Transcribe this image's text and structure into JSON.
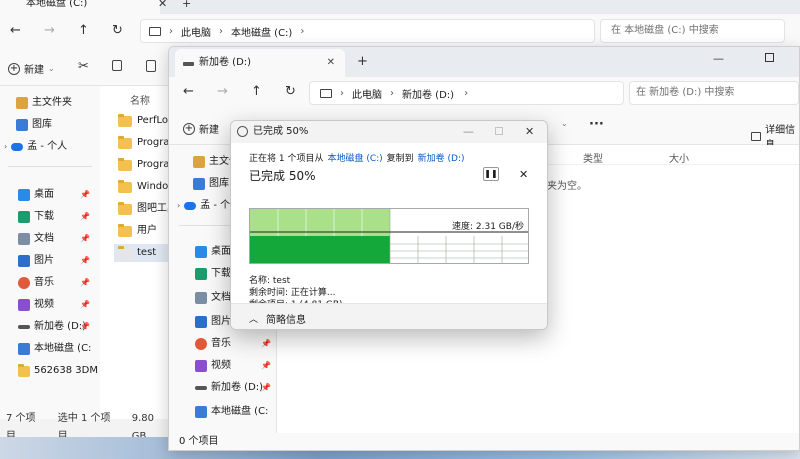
{
  "back_window": {
    "tab_title": "本地磁盘 (C:)",
    "breadcrumb": [
      "此电脑",
      "本地磁盘 (C:)"
    ],
    "search_placeholder": "在 本地磁盘 (C:) 中搜索",
    "new_label": "新建",
    "column_name": "名称",
    "nav": [
      {
        "label": "主文件夹",
        "icon": "home-icon"
      },
      {
        "label": "图库",
        "icon": "gallery-icon"
      },
      {
        "label": "孟 - 个人",
        "icon": "cloud-icon"
      },
      {
        "label": "桌面",
        "icon": "desktop-icon"
      },
      {
        "label": "下载",
        "icon": "download-icon"
      },
      {
        "label": "文档",
        "icon": "document-icon"
      },
      {
        "label": "图片",
        "icon": "pictures-icon"
      },
      {
        "label": "音乐",
        "icon": "music-icon"
      },
      {
        "label": "视频",
        "icon": "video-icon"
      },
      {
        "label": "新加卷 (D:)",
        "icon": "drive-icon"
      },
      {
        "label": "本地磁盘 (C:",
        "icon": "drive-icon"
      },
      {
        "label": "562638 3DM",
        "icon": "folder-icon"
      }
    ],
    "files": [
      "PerfLog",
      "Progran",
      "Progran",
      "Window",
      "图吧工具",
      "用户",
      "test"
    ],
    "status": {
      "count": "7 个项目",
      "selected": "选中 1 个项目",
      "size": "9.80 GB"
    }
  },
  "front_window": {
    "tab_title": "新加卷 (D:)",
    "breadcrumb": [
      "此电脑",
      "新加卷 (D:)"
    ],
    "search_placeholder": "在 新加卷 (D:) 中搜索",
    "new_label": "新建",
    "details_label": "详细信息",
    "columns": [
      "类型",
      "大小"
    ],
    "empty_text": "夹为空。",
    "nav": [
      {
        "label": "主文件",
        "icon": "home-icon"
      },
      {
        "label": "图库",
        "icon": "gallery-icon"
      },
      {
        "label": "孟 - 个",
        "icon": "cloud-icon"
      },
      {
        "label": "桌面",
        "icon": "desktop-icon"
      },
      {
        "label": "下载",
        "icon": "download-icon"
      },
      {
        "label": "文档",
        "icon": "document-icon"
      },
      {
        "label": "图片",
        "icon": "pictures-icon"
      },
      {
        "label": "音乐",
        "icon": "music-icon"
      },
      {
        "label": "视频",
        "icon": "video-icon"
      },
      {
        "label": "新加卷 (D:)",
        "icon": "drive-icon"
      },
      {
        "label": "本地磁盘 (C:",
        "icon": "drive-icon"
      }
    ],
    "status": "0 个项目"
  },
  "copy_dialog": {
    "title": "已完成 50%",
    "line_prefix": "正在将 1 个项目从",
    "source": "本地磁盘 (C:)",
    "line_mid": "复制到",
    "dest": "新加卷 (D:)",
    "progress_title": "已完成 50%",
    "progress": 0.5,
    "speed": "速度: 2.31 GB/秒",
    "name_label": "名称: test",
    "time_label": "剩余时间: 正在计算...",
    "items_label": "剩余项目: 1 (4.81 GB)",
    "less_info": "简略信息",
    "colors": {
      "top_fill": "#a9e089",
      "bottom_fill": "#14a83a",
      "link": "#0a59c4"
    }
  }
}
